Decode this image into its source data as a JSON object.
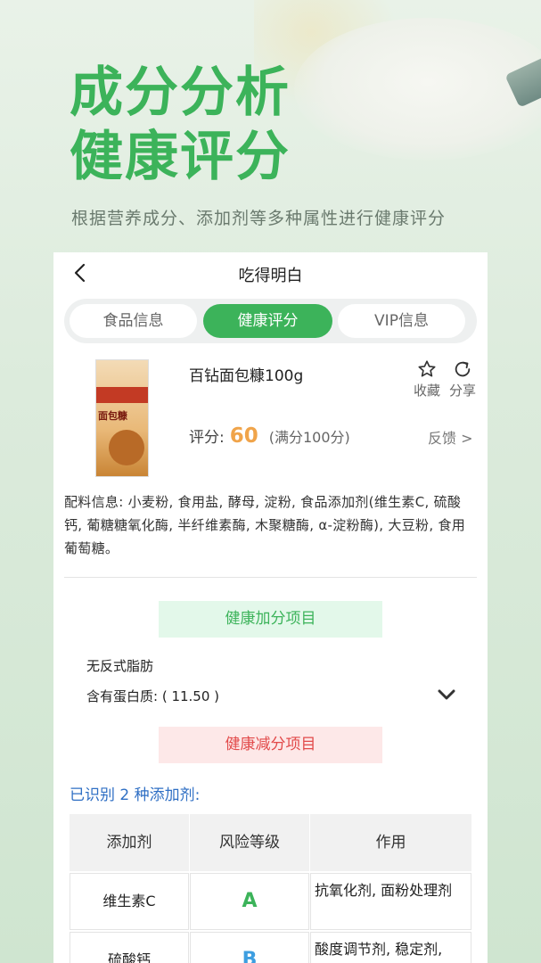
{
  "hero": {
    "line1": "成分分析",
    "line2": "健康评分",
    "subtitle": "根据营养成分、添加剂等多种属性进行健康评分"
  },
  "app": {
    "title": "吃得明白"
  },
  "tabs": [
    {
      "label": "食品信息",
      "active": false
    },
    {
      "label": "健康评分",
      "active": true
    },
    {
      "label": "VIP信息",
      "active": false
    }
  ],
  "product": {
    "name": "百钻面包糠100g",
    "thumb_label": "面包糠",
    "actions": {
      "favorite": "收藏",
      "share": "分享"
    },
    "score_label": "评分:",
    "score": "60",
    "score_full": "(满分100分)",
    "feedback": "反馈 >"
  },
  "ingredients": {
    "text": "配料信息: 小麦粉, 食用盐, 酵母, 淀粉, 食品添加剂(维生素C, 硫酸钙, 葡糖糖氧化酶, 半纤维素酶, 木聚糖酶, α-淀粉酶), 大豆粉, 食用葡萄糖。"
  },
  "health_plus": {
    "header": "健康加分项目",
    "items": [
      "无反式脂肪",
      "含有蛋白质:  ( 11.50 )"
    ]
  },
  "health_minus": {
    "header": "健康减分项目"
  },
  "additives": {
    "summary": "已识别 2 种添加剂:",
    "headers": [
      "添加剂",
      "风险等级",
      "作用"
    ],
    "rows": [
      {
        "name": "维生素C",
        "level": "A",
        "effect": "抗氧化剂, 面粉处理剂"
      },
      {
        "name": "硫酸钙",
        "level": "B",
        "effect": "酸度调节剂, 稳定剂,"
      }
    ]
  },
  "colors": {
    "brand_green": "#3cb35a",
    "score_orange": "#f0a44a",
    "minus_red": "#e24a4a",
    "link_blue": "#2f6fc4",
    "level_a": "#3cb35a",
    "level_b": "#3d9ee0"
  }
}
